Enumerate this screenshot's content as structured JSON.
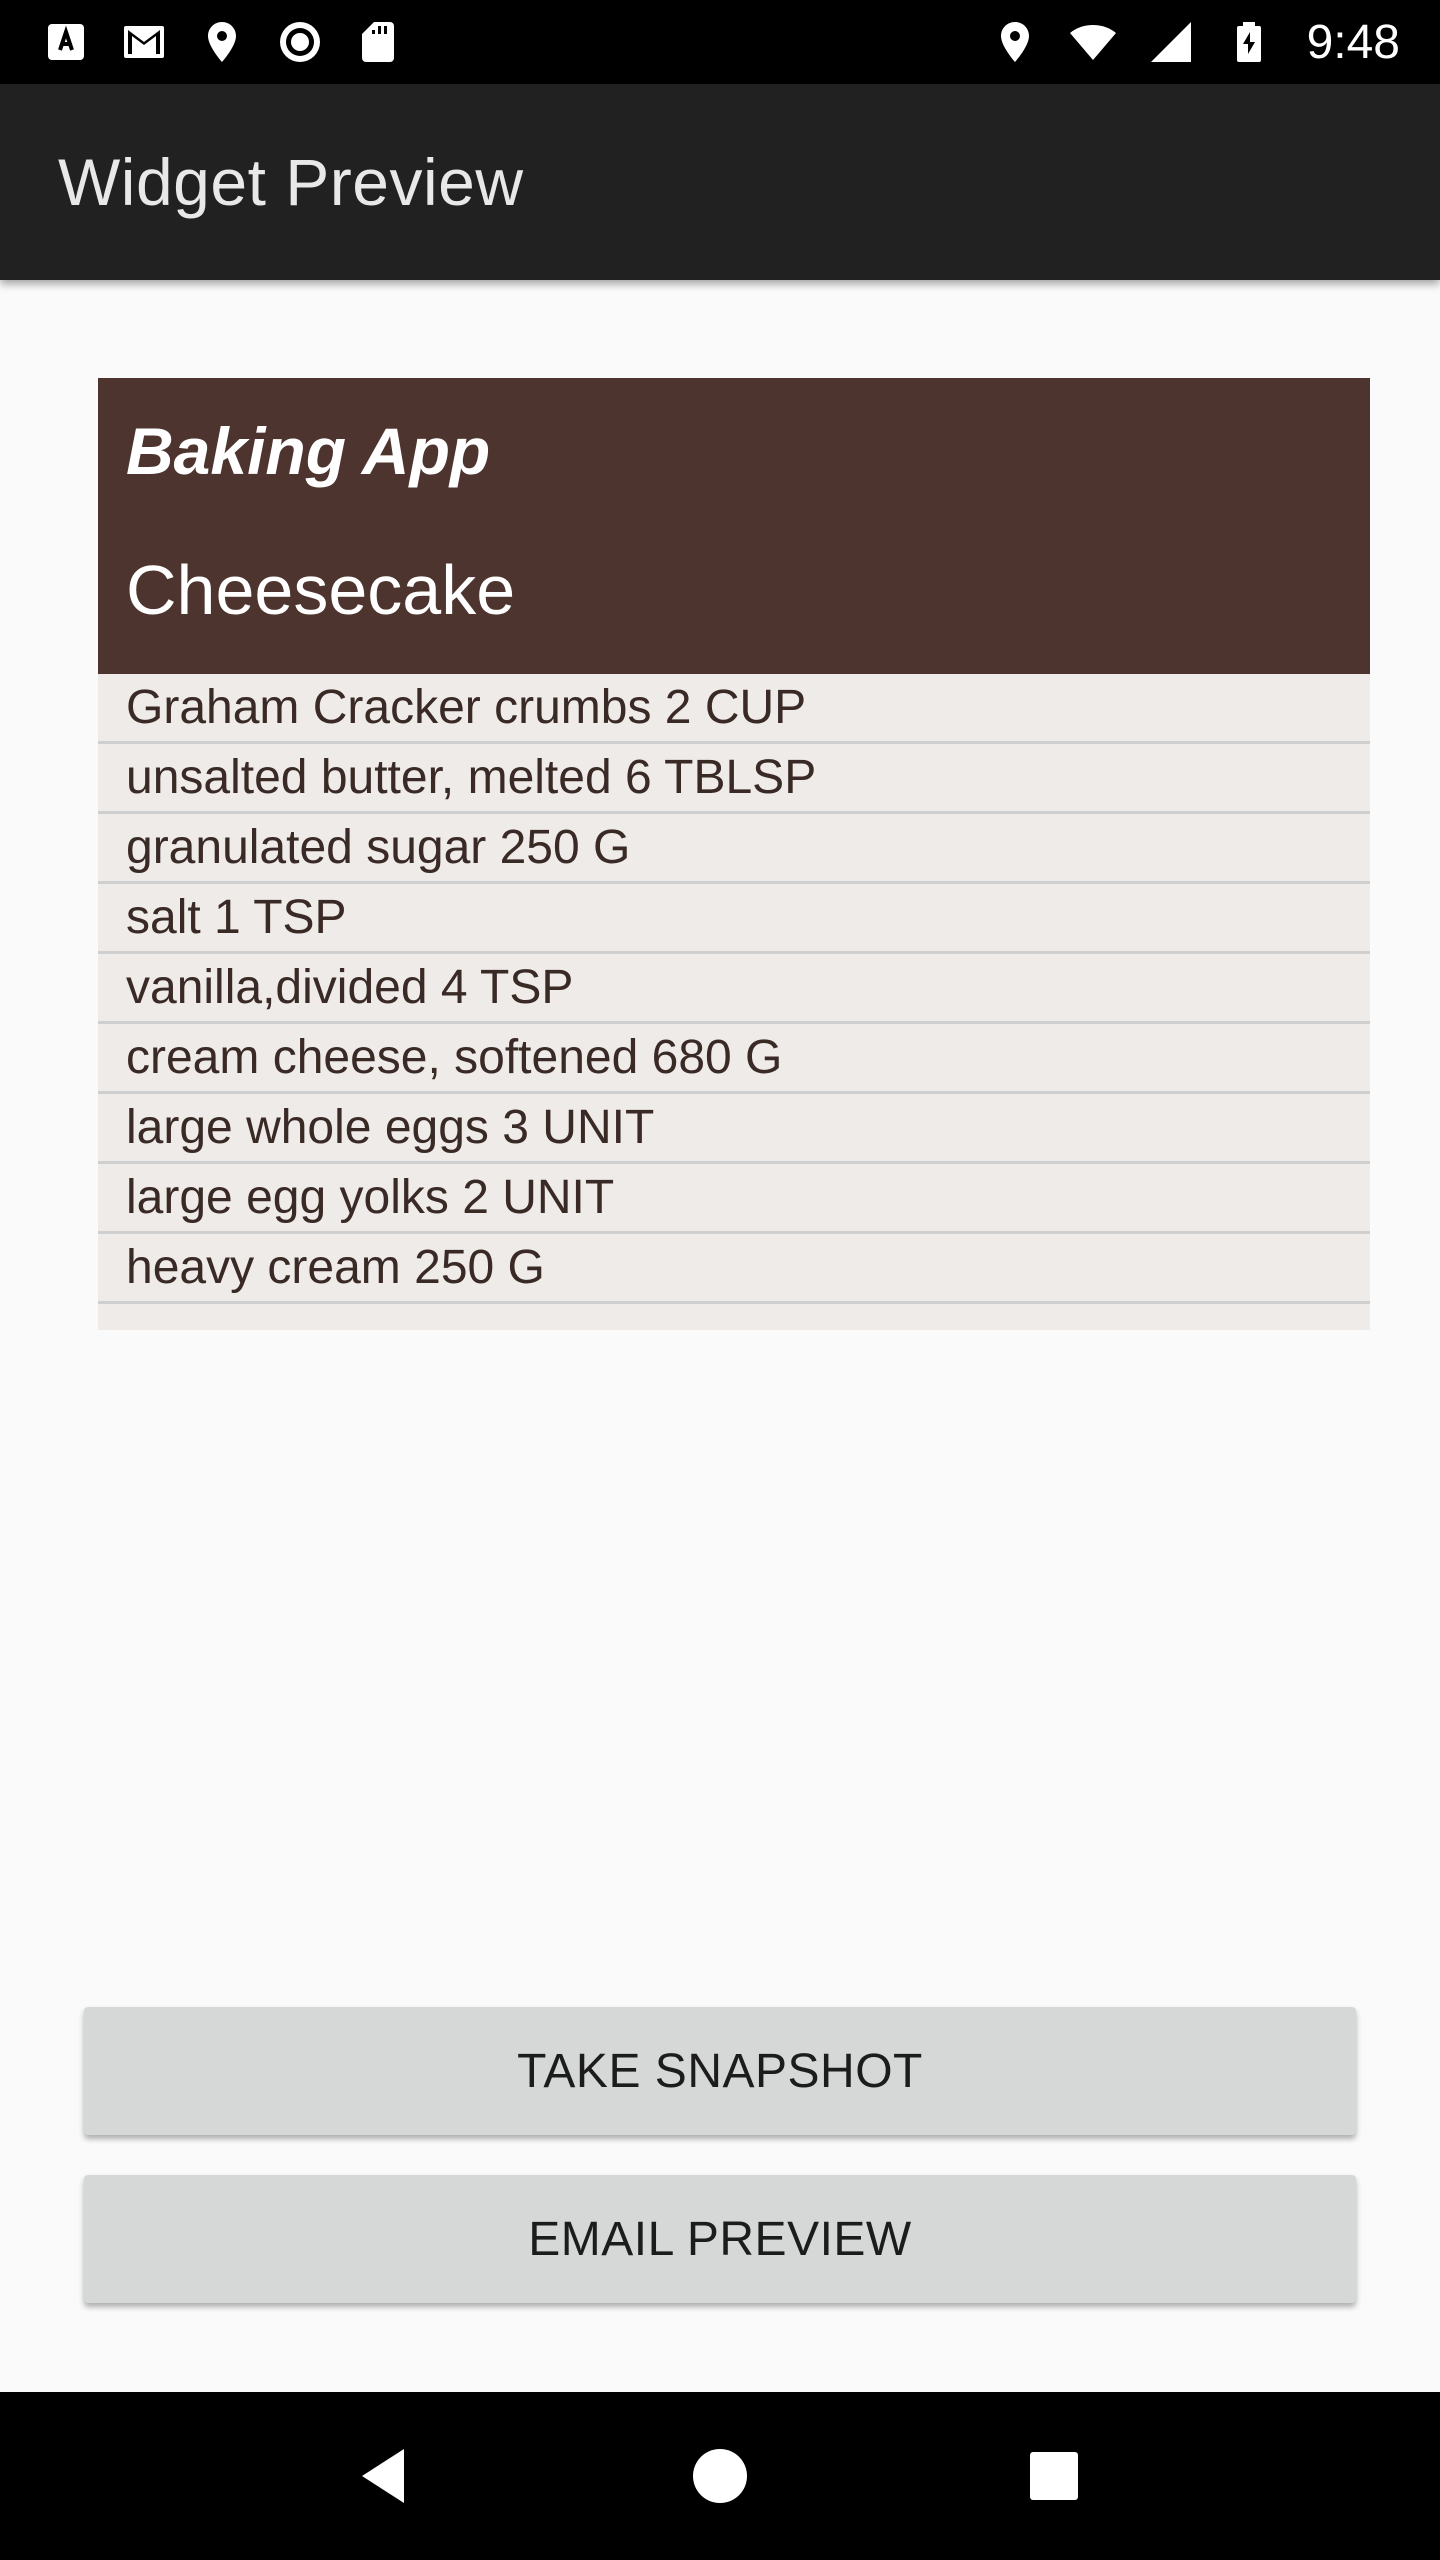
{
  "status_bar": {
    "time": "9:48",
    "left_icons": [
      "app-a-icon",
      "gmail-icon",
      "location-pin-icon",
      "record-icon",
      "sd-card-icon"
    ],
    "right_icons": [
      "location-pin-icon",
      "wifi-icon",
      "signal-icon",
      "battery-charging-icon"
    ]
  },
  "app_bar": {
    "title": "Widget Preview"
  },
  "widget": {
    "app_name": "Baking App",
    "recipe_name": "Cheesecake",
    "ingredients": [
      "Graham Cracker crumbs 2 CUP",
      "unsalted butter, melted 6 TBLSP",
      "granulated sugar 250 G",
      "salt 1 TSP",
      "vanilla,divided 4 TSP",
      "cream cheese, softened 680 G",
      "large whole eggs 3 UNIT",
      "large egg yolks 2 UNIT",
      "heavy cream 250 G"
    ]
  },
  "buttons": {
    "snapshot_label": "TAKE SNAPSHOT",
    "email_label": "EMAIL PREVIEW"
  },
  "colors": {
    "widget_header": "#4e342e",
    "widget_body": "#efebe9",
    "app_bar": "#212121",
    "button": "#d6d7d7"
  }
}
